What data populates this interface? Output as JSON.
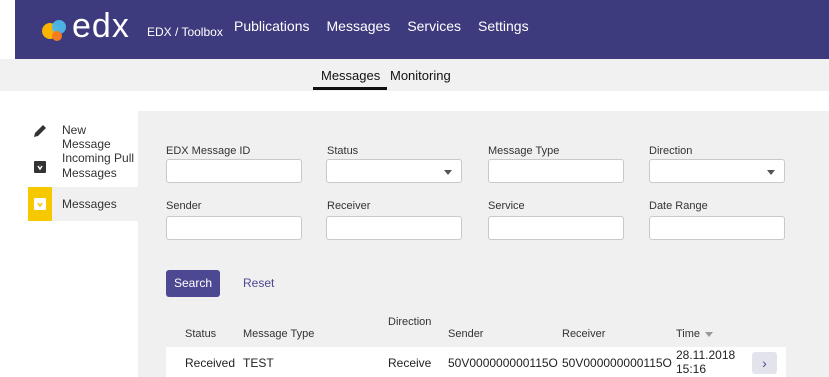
{
  "header": {
    "logo_text": "edx",
    "subtitle": "EDX / Toolbox",
    "nav": [
      "Publications",
      "Messages",
      "Services",
      "Settings"
    ]
  },
  "subnav": [
    "Messages",
    "Monitoring"
  ],
  "sidebar": {
    "items": [
      {
        "label": "New Message",
        "icon": "pencil-icon"
      },
      {
        "label": "Incoming Pull Messages",
        "icon": "inbox-icon"
      },
      {
        "label": "Messages",
        "icon": "inbox-icon"
      }
    ]
  },
  "filters": {
    "edx_message_id": "EDX Message ID",
    "status": "Status",
    "message_type": "Message Type",
    "direction": "Direction",
    "sender": "Sender",
    "receiver": "Receiver",
    "service": "Service",
    "date_range": "Date Range"
  },
  "actions": {
    "search": "Search",
    "reset": "Reset"
  },
  "table": {
    "headers": [
      "Status",
      "Message Type",
      "Direction",
      "Sender",
      "Receiver",
      "Time"
    ],
    "rows": [
      {
        "status": "Received",
        "type": "TEST",
        "direction": "Receive",
        "sender": "50V000000000115O",
        "receiver": "50V000000000115O",
        "time_line1": "28.11.2018",
        "time_line2": "15:16"
      }
    ]
  },
  "colors": {
    "primary": "#3d3a7d",
    "accent": "#f5c800",
    "button": "#4c4891"
  }
}
